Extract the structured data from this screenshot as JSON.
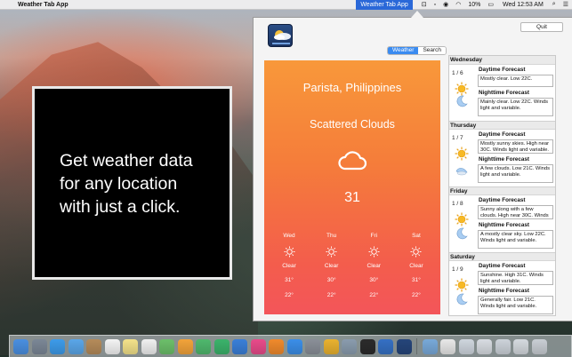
{
  "menubar": {
    "apple_glyph": "",
    "app_name": "Weather Tab App",
    "active_item": "Weather Tab App",
    "battery": "10%",
    "clock": "Wed 12:53 AM",
    "status_icons": [
      "menu-extra-icon",
      "camera-icon",
      "eye-icon",
      "wifi-icon",
      "battery-icon",
      "search-icon",
      "list-icon"
    ]
  },
  "promo": {
    "line1": "Get weather data",
    "line2": "for any location",
    "line3": "with just a click."
  },
  "popover": {
    "quit_label": "Quit",
    "tabs": [
      {
        "label": "Weather",
        "selected": true
      },
      {
        "label": "Search",
        "selected": false
      }
    ],
    "current": {
      "city": "Parista, Philippines",
      "condition": "Scattered Clouds",
      "temperature": "31",
      "icon": "cloud-icon"
    },
    "days": [
      {
        "name": "Wed",
        "condition": "Clear",
        "high": "31°",
        "low": "22°",
        "icon": "sun-icon"
      },
      {
        "name": "Thu",
        "condition": "Clear",
        "high": "30°",
        "low": "22°",
        "icon": "sun-icon"
      },
      {
        "name": "Fri",
        "condition": "Clear",
        "high": "30°",
        "low": "22°",
        "icon": "sun-icon"
      },
      {
        "name": "Sat",
        "condition": "Clear",
        "high": "31°",
        "low": "22°",
        "icon": "sun-icon"
      }
    ],
    "forecast": [
      {
        "day": "Wednesday",
        "date": "1 / 6",
        "daytime_label": "Daytime Forecast",
        "daytime_text": "Mostly clear. Low 22C.",
        "night_label": "Nighttime Forecast",
        "night_text": "Mainly clear. Low 22C. Winds light and variable.",
        "day_icon": "sun-icon",
        "night_icon": "moon-icon"
      },
      {
        "day": "Thursday",
        "date": "1 / 7",
        "daytime_label": "Daytime Forecast",
        "daytime_text": "Mostly sunny skies. High near 30C. Winds light and variable.",
        "night_label": "Nighttime Forecast",
        "night_text": "A few clouds. Low 21C. Winds light and variable.",
        "day_icon": "sun-icon",
        "night_icon": "cloudy-moon-icon"
      },
      {
        "day": "Friday",
        "date": "1 / 8",
        "daytime_label": "Daytime Forecast",
        "daytime_text": "Sunny along with a few clouds. High near 30C. Winds light and",
        "night_label": "Nighttime Forecast",
        "night_text": "A mostly clear sky. Low 22C. Winds light and variable.",
        "day_icon": "sun-icon",
        "night_icon": "moon-icon"
      },
      {
        "day": "Saturday",
        "date": "1 / 9",
        "daytime_label": "Daytime Forecast",
        "daytime_text": "Sunshine. High 31C. Winds light and variable.",
        "night_label": "Nighttime Forecast",
        "night_text": "Generally fair. Low 21C. Winds light and variable.",
        "day_icon": "sun-icon",
        "night_icon": "moon-icon"
      }
    ]
  },
  "dock": {
    "apps": [
      {
        "icon": "finder-icon",
        "color": "#4a8fe0"
      },
      {
        "icon": "launchpad-icon",
        "color": "#7b8796"
      },
      {
        "icon": "safari-icon",
        "color": "#3d9be9"
      },
      {
        "icon": "mail-icon",
        "color": "#5aa6e8"
      },
      {
        "icon": "contacts-icon",
        "color": "#b58b5a"
      },
      {
        "icon": "calendar-icon",
        "color": "#f4f4f4"
      },
      {
        "icon": "notes-icon",
        "color": "#f3e28a"
      },
      {
        "icon": "reminders-icon",
        "color": "#f0f0f0"
      },
      {
        "icon": "maps-icon",
        "color": "#6cbf6a"
      },
      {
        "icon": "photos-icon",
        "color": "#f2a33a"
      },
      {
        "icon": "facetime-icon",
        "color": "#4fb86d"
      },
      {
        "icon": "numbers-icon",
        "color": "#3bb36b"
      },
      {
        "icon": "keynote-icon",
        "color": "#3a7fd8"
      },
      {
        "icon": "itunes-icon",
        "color": "#e84b8a"
      },
      {
        "icon": "ibooks-icon",
        "color": "#f08a2c"
      },
      {
        "icon": "app-store-icon",
        "color": "#3b8ee8"
      },
      {
        "icon": "system-preferences-icon",
        "color": "#8a8f98"
      },
      {
        "icon": "chrome-icon",
        "color": "#e9b22f"
      },
      {
        "icon": "preview-icon",
        "color": "#8a9cae"
      },
      {
        "icon": "terminal-icon",
        "color": "#2b2b2b"
      },
      {
        "icon": "xcode-icon",
        "color": "#3570c4"
      },
      {
        "icon": "weather-tab-icon",
        "color": "#25457a"
      }
    ],
    "others": [
      {
        "icon": "folder-icon",
        "color": "#78a9d9"
      },
      {
        "icon": "document-icon",
        "color": "#e8e8e8"
      },
      {
        "icon": "window-icon",
        "color": "#cfd6de"
      },
      {
        "icon": "window-icon",
        "color": "#d8dce2"
      },
      {
        "icon": "window-icon",
        "color": "#cdd3da"
      },
      {
        "icon": "window-icon",
        "color": "#d5dadf"
      },
      {
        "icon": "trash-icon",
        "color": "#c9ced4"
      }
    ]
  }
}
